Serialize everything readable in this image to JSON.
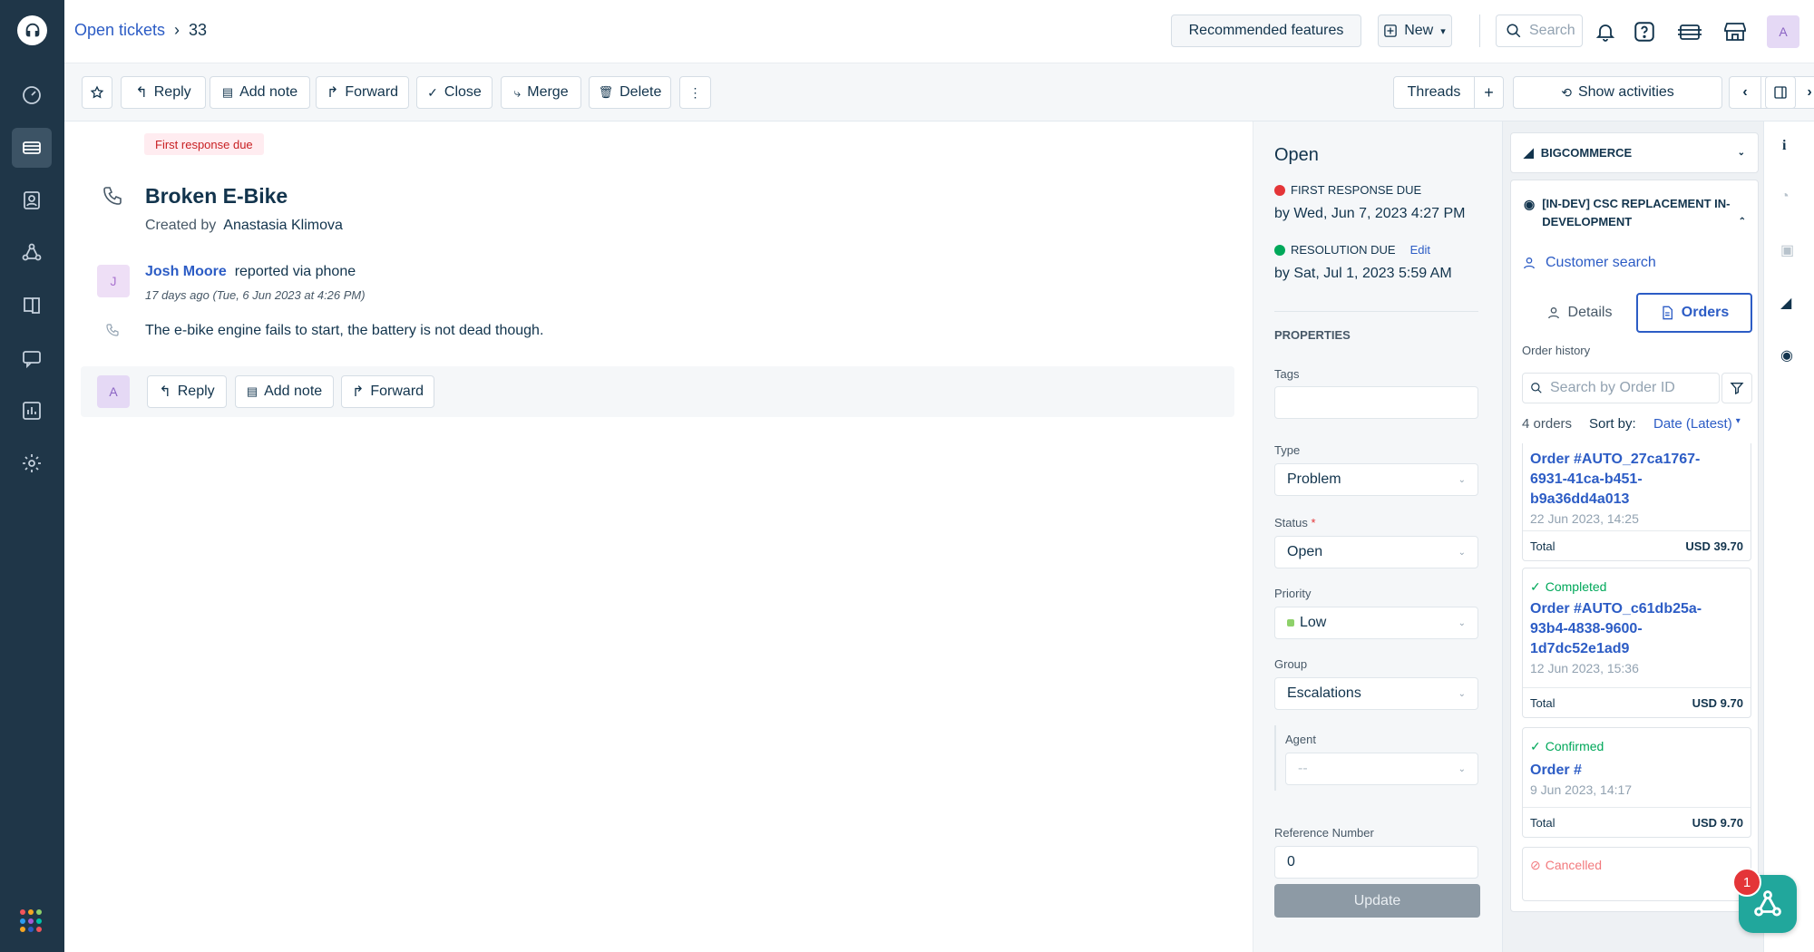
{
  "nav": {
    "items": [
      "dashboard-icon",
      "tickets-icon",
      "contacts-icon",
      "groups-icon",
      "knowledge-base-icon",
      "chat-icon",
      "reports-icon",
      "settings-icon"
    ]
  },
  "breadcrumb": {
    "parent": "Open tickets",
    "current": "33"
  },
  "header": {
    "recommended": "Recommended features",
    "new": "New",
    "search_placeholder": "Search",
    "avatar": "A"
  },
  "toolbar": {
    "reply": "Reply",
    "add_note": "Add note",
    "forward": "Forward",
    "close": "Close",
    "merge": "Merge",
    "delete": "Delete",
    "threads": "Threads",
    "show_activities": "Show activities",
    "ellipsis": "···"
  },
  "ticket": {
    "badge": "First response due",
    "title": "Broken E-Bike",
    "created_by_label": "Created by",
    "created_by": "Anastasia Klimova",
    "requester_initial": "J",
    "requester": "Josh Moore",
    "reported_via": "reported via phone",
    "time": "17 days ago (Tue, 6 Jun 2023 at 4:26 PM)",
    "body": "The e-bike engine fails to start, the battery is not dead though.",
    "agent_initial": "A"
  },
  "reply_bar": {
    "reply": "Reply",
    "add_note": "Add note",
    "forward": "Forward"
  },
  "props": {
    "status_title": "Open",
    "first_response_label": "FIRST RESPONSE DUE",
    "first_response_value": "by Wed, Jun 7, 2023 4:27 PM",
    "resolution_label": "RESOLUTION DUE",
    "edit": "Edit",
    "resolution_value": "by Sat, Jul 1, 2023 5:59 AM",
    "properties_heading": "PROPERTIES",
    "tags_label": "Tags",
    "type_label": "Type",
    "type_value": "Problem",
    "status_label": "Status",
    "required_mark": "*",
    "status_value": "Open",
    "priority_label": "Priority",
    "priority_value": "Low",
    "group_label": "Group",
    "group_value": "Escalations",
    "agent_label": "Agent",
    "agent_value": "--",
    "ref_label": "Reference Number",
    "ref_value": "0",
    "update": "Update",
    "colors": {
      "first_response": "#e43538",
      "resolution": "#00a85a",
      "priority_low": "#8ed16a"
    }
  },
  "apps": {
    "bigcommerce": "BIGCOMMERCE",
    "csc_title": "[IN-DEV] CSC REPLACEMENT IN-DEVELOPMENT",
    "customer_search": "Customer search",
    "tab_details": "Details",
    "tab_orders": "Orders",
    "order_history": "Order history",
    "search_placeholder": "Search by Order ID",
    "orders_count": "4 orders",
    "sort_by": "Sort by:",
    "sort_value": "Date (Latest)",
    "orders": [
      {
        "status": "",
        "id": "Order #AUTO_27ca1767-6931-41ca-b451-b9a36dd4a013",
        "date": "22 Jun 2023, 14:25",
        "total_label": "Total",
        "total": "USD 39.70"
      },
      {
        "status": "Completed",
        "id": "Order #AUTO_c61db25a-93b4-4838-9600-1d7dc52e1ad9",
        "date": "12 Jun 2023, 15:36",
        "total_label": "Total",
        "total": "USD 9.70"
      },
      {
        "status": "Confirmed",
        "id": "Order #",
        "date": "9 Jun 2023, 14:17",
        "total_label": "Total",
        "total": "USD 9.70"
      },
      {
        "status": "Cancelled",
        "id": "",
        "date": "",
        "total_label": "",
        "total": ""
      }
    ]
  },
  "notification_count": "1"
}
